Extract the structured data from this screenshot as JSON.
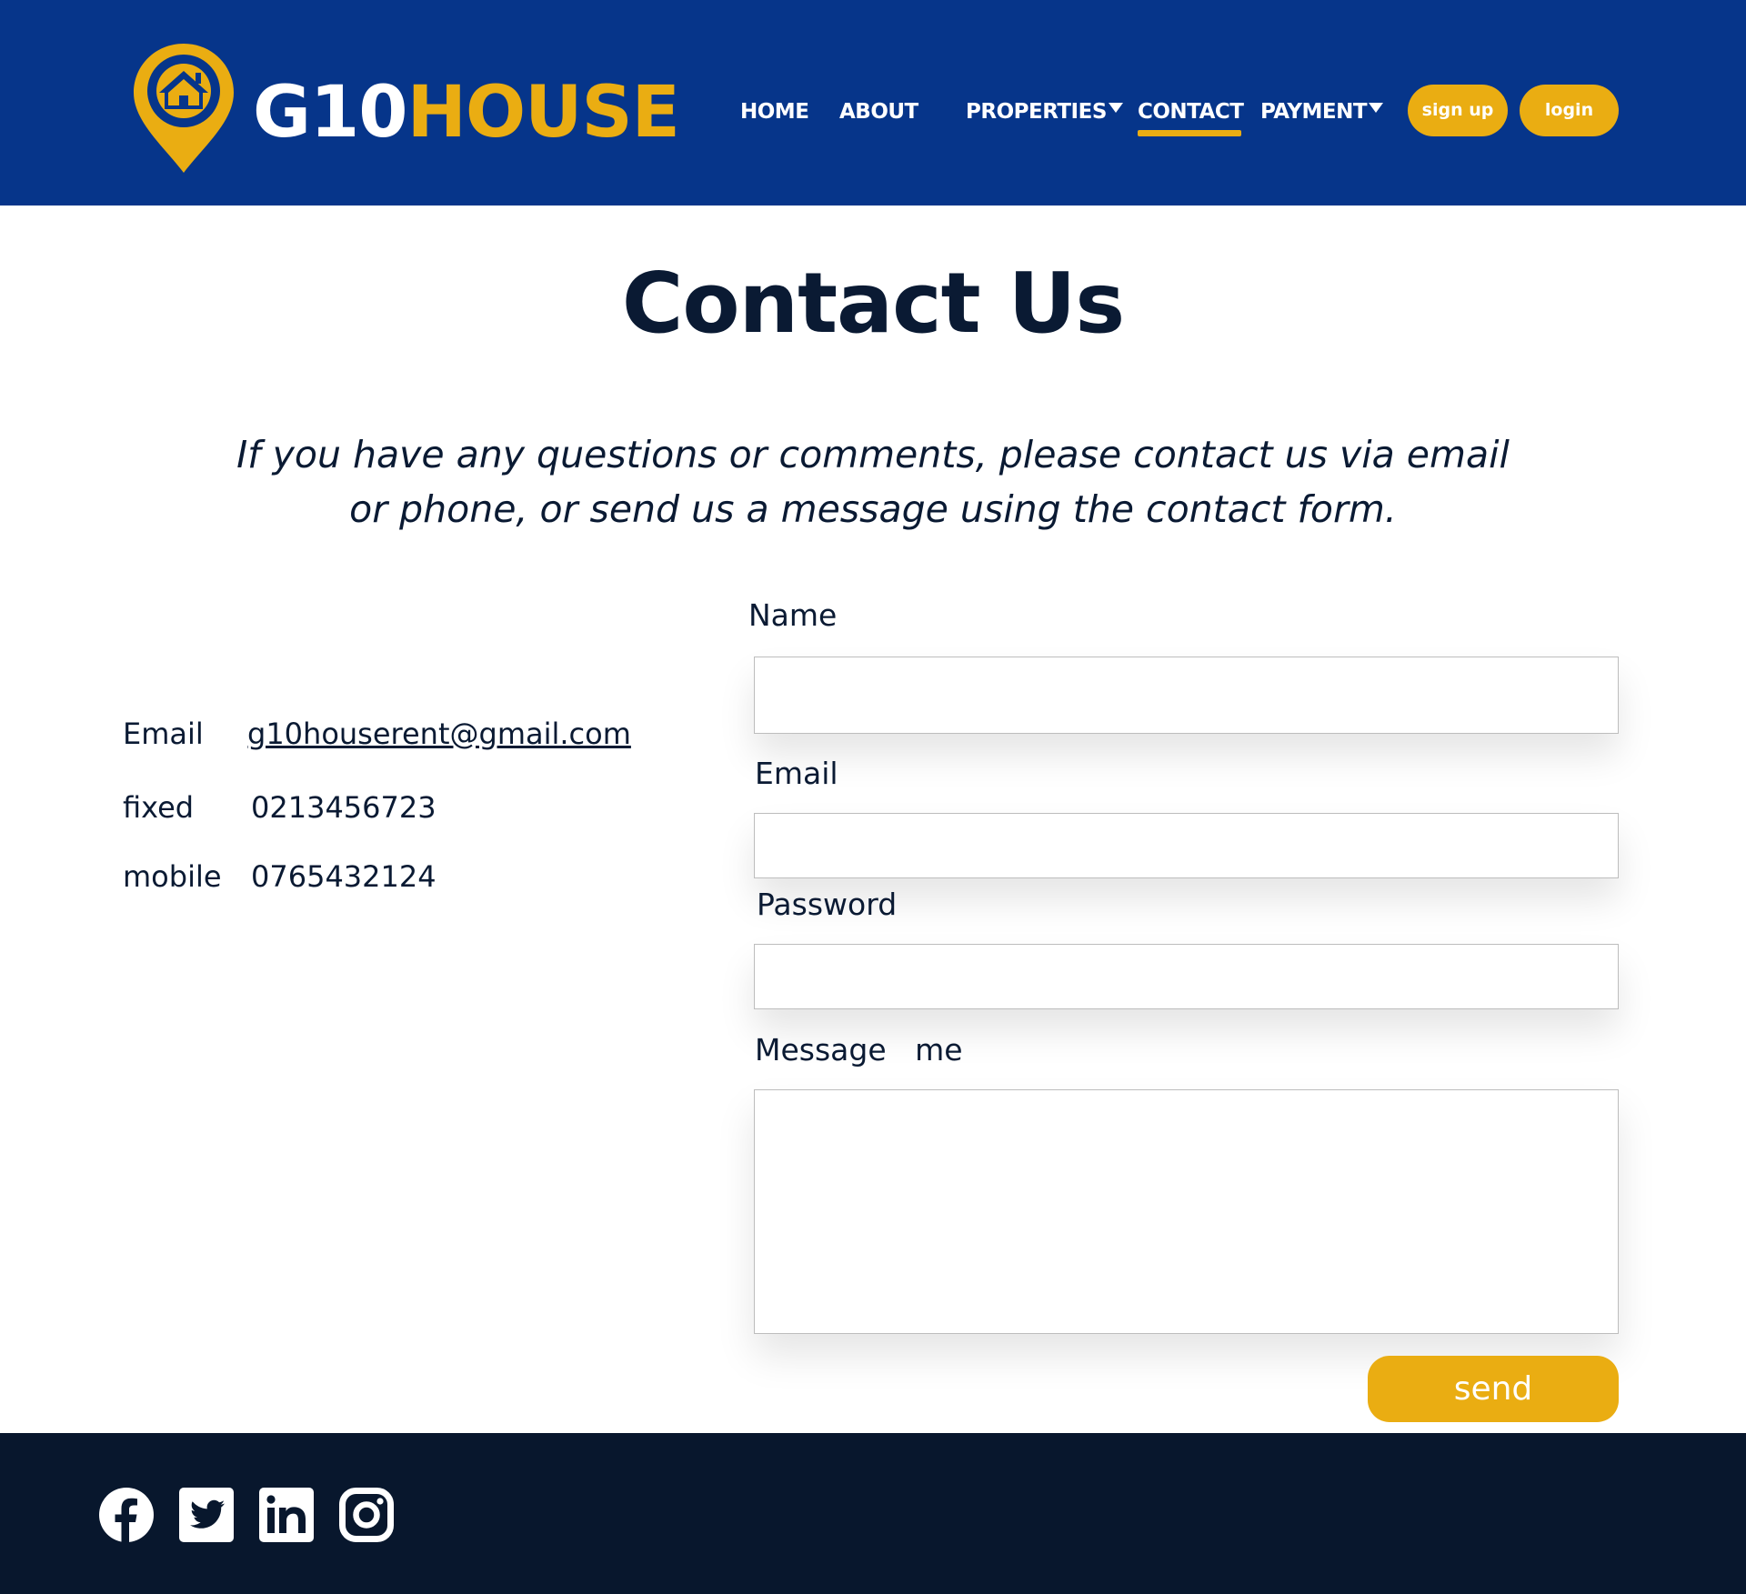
{
  "brand": {
    "part1": "G10",
    "part2": "HOUSE"
  },
  "nav": {
    "home": "HOME",
    "about": "ABOUT",
    "properties": "PROPERTIES",
    "contact": "CONTACT",
    "payment": "PAYMENT",
    "signup": "sign up",
    "login": "login"
  },
  "page": {
    "title": "Contact Us",
    "intro_line1": "If you have any questions or comments, please contact us via email",
    "intro_line2": "or phone, or send us a message using the contact form."
  },
  "contact_info": [
    {
      "label": "Email",
      "value": "g10houserent@gmail.com"
    },
    {
      "label": "fixed",
      "value": "0213456723"
    },
    {
      "label": "mobile",
      "value": "0765432124"
    }
  ],
  "form": {
    "name_label": "Name",
    "email_label": "Email",
    "password_label": "Password",
    "message_label": "Message   me",
    "name_value": "",
    "email_value": "",
    "password_value": "",
    "message_value": "",
    "send_label": "send"
  },
  "colors": {
    "header_bg": "#06358a",
    "accent": "#eaad12",
    "footer_bg": "#08172d",
    "text": "#0a1a33"
  },
  "footer": {
    "social_icons": [
      "facebook-icon",
      "twitter-icon",
      "linkedin-icon",
      "instagram-icon"
    ]
  }
}
